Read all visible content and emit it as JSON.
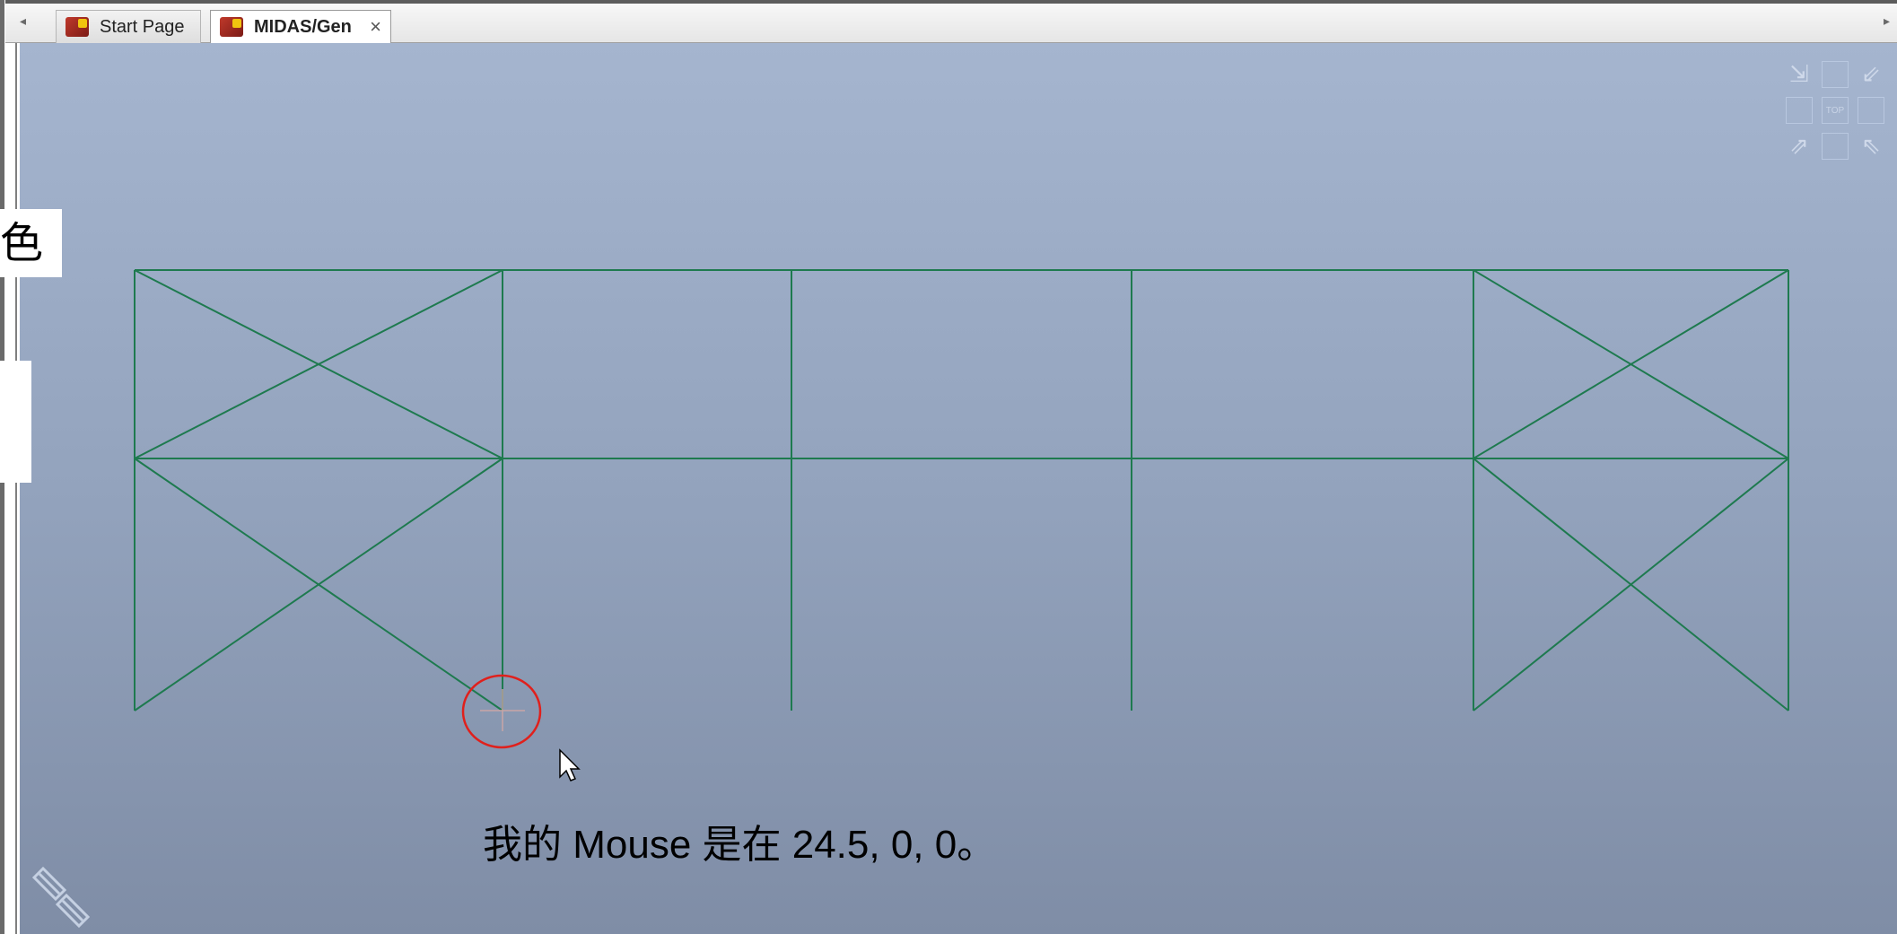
{
  "tabs": [
    {
      "label": "Start Page",
      "active": false
    },
    {
      "label": "MIDAS/Gen",
      "active": true
    }
  ],
  "tab_close_glyph": "×",
  "scroll_left_glyph": "◂",
  "scroll_right_glyph": "▸",
  "left_overlay": {
    "char1": "色",
    "char2": "。"
  },
  "caption": "我的 Mouse 是在 24.5, 0, 0。",
  "viewcube": {
    "label": "TOP"
  },
  "colors": {
    "frame_line": "#1e7a4f",
    "highlight_circle": "#e0201c",
    "viewport_top": "#a5b5cf",
    "viewport_bottom": "#7f8da6"
  },
  "icons": [
    "app-icon",
    "close-icon",
    "viewcube-icon",
    "pencil-icon",
    "cursor-arrow-icon",
    "crosshair-icon"
  ]
}
